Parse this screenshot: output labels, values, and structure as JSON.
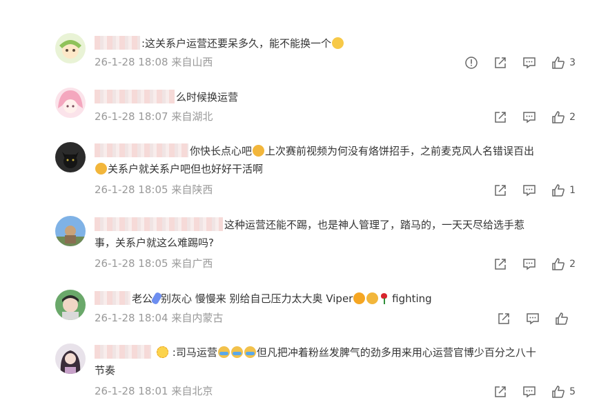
{
  "comments": [
    {
      "text": ":这关系户运营还要呆多久，能不能换一个",
      "time": "26-1-28 18:08",
      "location": "来自山西",
      "likes": "3"
    },
    {
      "text": "么时候换运营",
      "time": "26-1-28 18:07",
      "location": "来自湖北",
      "likes": "2"
    },
    {
      "text_line1": "你快长点心吧",
      "text_line1b": "上次赛前视频为何没有烙饼招手，之前麦克风人名错误百出",
      "text_line2": "关系户就关系户吧但也好好干活啊",
      "time": "26-1-28 18:05",
      "location": "来自陕西",
      "likes": "1"
    },
    {
      "text_line1": "这种运营还能不踢，也是神人管理了，踏马的，一天天尽给选手惹",
      "text_line2": "事，关系户就这么难踢吗?",
      "time": "26-1-28 18:05",
      "location": "来自广西",
      "likes": "2"
    },
    {
      "text_a": "老公",
      "text_b": "别灰心 慢慢来 别给自己压力太大奥 Viper",
      "text_c": "fighting",
      "time": "26-1-28 18:04",
      "location": "来自内蒙古",
      "likes": ""
    },
    {
      "text_a": ":司马运营",
      "text_b": "但凡把冲着粉丝发脾气的劲多用来用心运营官博少百分之八十",
      "text_line2": "节奏",
      "time": "26-1-28 18:01",
      "location": "来自北京",
      "likes": "5"
    }
  ],
  "icons": [
    "report-icon",
    "forward-icon",
    "comment-icon",
    "like-icon"
  ],
  "colors": {
    "meta": "#999999",
    "text": "#333333",
    "emoji": "#f7c948"
  }
}
